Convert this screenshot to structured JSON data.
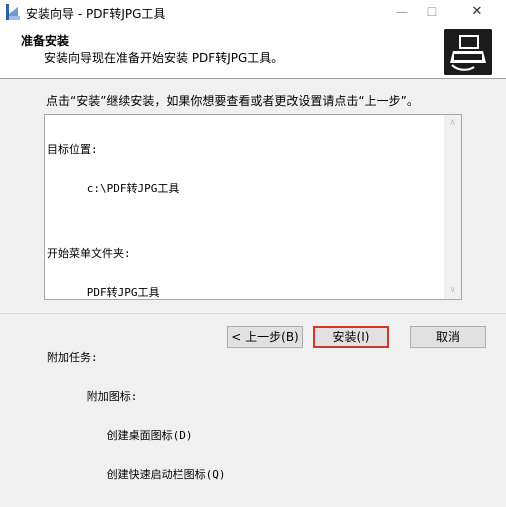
{
  "window": {
    "title": "安装向导 - PDF转JPG工具",
    "minimize_glyph": "—",
    "maximize_glyph": "☐",
    "close_glyph": "✕"
  },
  "header": {
    "title": "准备安装",
    "subtitle": "安装向导现在准备开始安装 PDF转JPG工具。"
  },
  "instruction": "点击“安装”继续安装，如果你想要查看或者更改设置请点击“上一步”。",
  "memo": {
    "lines": [
      "目标位置:",
      "      c:\\PDF转JPG工具",
      "",
      "开始菜单文件夹:",
      "      PDF转JPG工具",
      "",
      "附加任务:",
      "      附加图标:",
      "         创建桌面图标(D)",
      "         创建快速启动栏图标(Q)"
    ],
    "scroll_up_glyph": "∧",
    "scroll_down_glyph": "∨"
  },
  "buttons": {
    "back": "< 上一步(B)",
    "install": "安装(I)",
    "cancel": "取消"
  },
  "colors": {
    "highlight_border": "#d9342c",
    "focus_border": "#0078d7"
  }
}
